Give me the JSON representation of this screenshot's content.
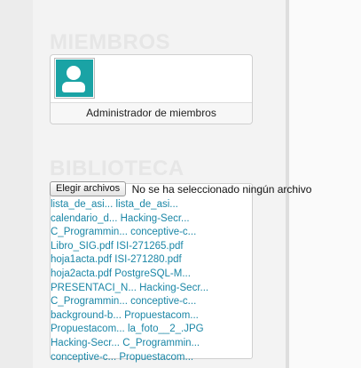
{
  "sections": {
    "members_title": "MIEMBROS",
    "library_title": "BIBLIOTECA"
  },
  "members": {
    "avatar_icon": "user-silhouette-icon",
    "manage_label": "Administrador de miembros"
  },
  "library": {
    "choose_button": "Elegir archivos",
    "no_file_text": "No se ha seleccionado ningún archivo",
    "rows": [
      [
        "lista_de_asi...",
        "lista_de_asi..."
      ],
      [
        "calendario_d...",
        "Hacking-Secr..."
      ],
      [
        "C_Programmin...",
        "conceptive-c..."
      ],
      [
        "Libro_SIG.pdf",
        "ISI-271265.pdf"
      ],
      [
        "hoja1acta.pdf",
        "ISI-271280.pdf"
      ],
      [
        "hoja2acta.pdf",
        "PostgreSQL-M..."
      ],
      [
        "PRESENTACI_N...",
        "Hacking-Secr..."
      ],
      [
        "C_Programmin...",
        "conceptive-c..."
      ],
      [
        "background-b...",
        "Propuestacom..."
      ],
      [
        "Propuestacom...",
        "la_foto__2_.JPG"
      ],
      [
        "Hacking-Secr...",
        "C_Programmin..."
      ],
      [
        "conceptive-c...",
        "Propuestacom..."
      ]
    ]
  },
  "colors": {
    "link": "#1a86a6",
    "avatar_bg": "#1aa3a5"
  }
}
